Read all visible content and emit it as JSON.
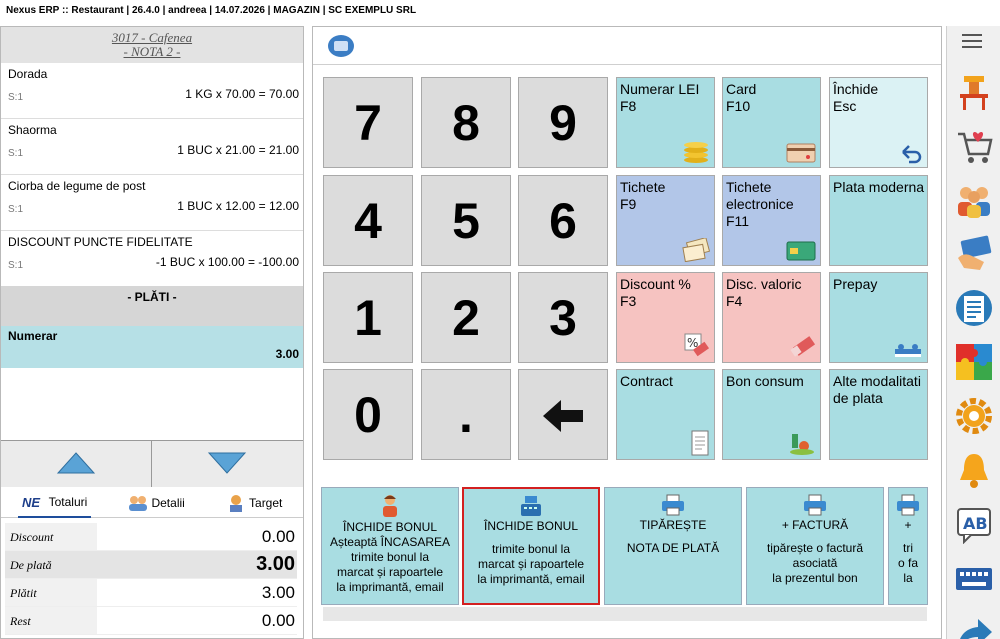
{
  "window": {
    "title": "Nexus ERP :: Restaurant | 26.4.0 | andreea | 14.07.2026 | MAGAZIN | SC EXEMPLU SRL"
  },
  "order": {
    "table": "3017 - Cafenea",
    "note": "- NOTA 2 -",
    "items": [
      {
        "name": "Dorada",
        "sub": "S:1",
        "calc": "1 KG x 70.00 = 70.00"
      },
      {
        "name": "Shaorma",
        "sub": "S:1",
        "calc": "1 BUC x 21.00 = 21.00"
      },
      {
        "name": "Ciorba de legume de post",
        "sub": "S:1",
        "calc": "1 BUC x 12.00 = 12.00"
      },
      {
        "name": "DISCOUNT PUNCTE FIDELITATE",
        "sub": "S:1",
        "calc": "-1 BUC x 100.00 = -100.00"
      }
    ],
    "payments_header": "- PLĂTI -",
    "payment": {
      "name": "Numerar",
      "value": "3.00"
    }
  },
  "tabs": {
    "totaluri": "Totaluri",
    "detalii": "Detalii",
    "target": "Target"
  },
  "totals": [
    {
      "label": "Discount",
      "value": "0.00"
    },
    {
      "label": "De plată",
      "value": "3.00"
    },
    {
      "label": "Plătit",
      "value": "3.00"
    },
    {
      "label": "Rest",
      "value": "0.00"
    }
  ],
  "keypad": [
    "7",
    "8",
    "9",
    "4",
    "5",
    "6",
    "1",
    "2",
    "3",
    "0",
    "."
  ],
  "functions": {
    "numerar": {
      "line1": "Numerar LEI",
      "line2": "F8"
    },
    "card": {
      "line1": "Card",
      "line2": "F10"
    },
    "inchide": {
      "line1": "Închide",
      "line2": "Esc"
    },
    "tichete": {
      "line1": "Tichete",
      "line2": "F9"
    },
    "tichete_el": {
      "line1": "Tichete",
      "line2": "electronice",
      "line3": "F11"
    },
    "plata_moderna": {
      "line1": "Plata moderna"
    },
    "discount": {
      "line1": "Discount %",
      "line2": "F3"
    },
    "disc_valoric": {
      "line1": "Disc. valoric",
      "line2": "F4"
    },
    "prepay": {
      "line1": "Prepay"
    },
    "contract": {
      "line1": "Contract"
    },
    "bon_consum": {
      "line1": "Bon consum"
    },
    "alte": {
      "line1": "Alte modalitati",
      "line2": "de plata"
    }
  },
  "actions": [
    {
      "title": "ÎNCHIDE BONUL",
      "title2": "Așteaptă ÎNCASAREA",
      "desc": [
        "trimite bonul la",
        "marcat și rapoartele",
        "la imprimantă, email"
      ]
    },
    {
      "title": "ÎNCHIDE BONUL",
      "desc": [
        "trimite bonul la",
        "marcat și rapoartele",
        "la imprimantă, email"
      ]
    },
    {
      "title": "TIPĂREȘTE",
      "title2": "NOTA DE PLATĂ"
    },
    {
      "title": "+ FACTURĂ",
      "desc": [
        "tipărește o factură",
        "asociată",
        "la prezentul bon"
      ]
    },
    {
      "title": "+",
      "desc": [
        "tri",
        "o fa",
        "la"
      ]
    }
  ]
}
